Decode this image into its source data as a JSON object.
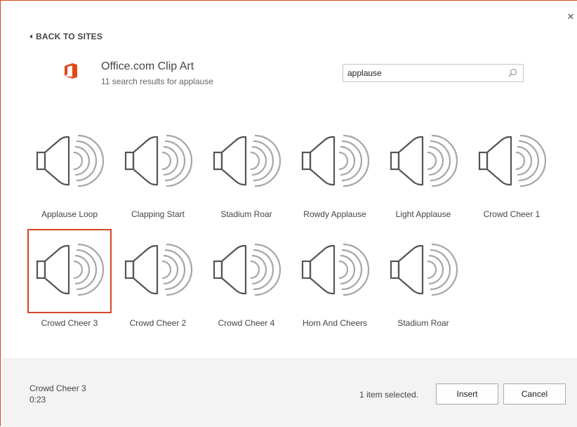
{
  "dialog": {
    "close_glyph": "✕",
    "back_label": "BACK TO SITES",
    "site_title": "Office.com Clip Art",
    "site_subtitle": "11 search results for applause",
    "accent_color": "#d24726"
  },
  "search": {
    "value": "applause"
  },
  "results": [
    {
      "label": "Applause Loop",
      "selected": false,
      "icon": "speaker-icon"
    },
    {
      "label": "Clapping Start",
      "selected": false,
      "icon": "speaker-icon"
    },
    {
      "label": "Stadium Roar",
      "selected": false,
      "icon": "speaker-icon"
    },
    {
      "label": "Rowdy Applause",
      "selected": false,
      "icon": "speaker-icon"
    },
    {
      "label": "Light Applause",
      "selected": false,
      "icon": "speaker-icon"
    },
    {
      "label": "Crowd Cheer 1",
      "selected": false,
      "icon": "speaker-icon"
    },
    {
      "label": "Crowd Cheer 3",
      "selected": true,
      "icon": "speaker-icon"
    },
    {
      "label": "Crowd Cheer 2",
      "selected": false,
      "icon": "speaker-icon"
    },
    {
      "label": "Crowd Cheer 4",
      "selected": false,
      "icon": "speaker-icon"
    },
    {
      "label": "Horn And Cheers",
      "selected": false,
      "icon": "speaker-icon"
    },
    {
      "label": "Stadium Roar",
      "selected": false,
      "icon": "speaker-icon"
    }
  ],
  "footer": {
    "selected_name": "Crowd Cheer 3",
    "selected_duration": "0:23",
    "status": "1 item selected.",
    "insert_label": "Insert",
    "cancel_label": "Cancel"
  }
}
